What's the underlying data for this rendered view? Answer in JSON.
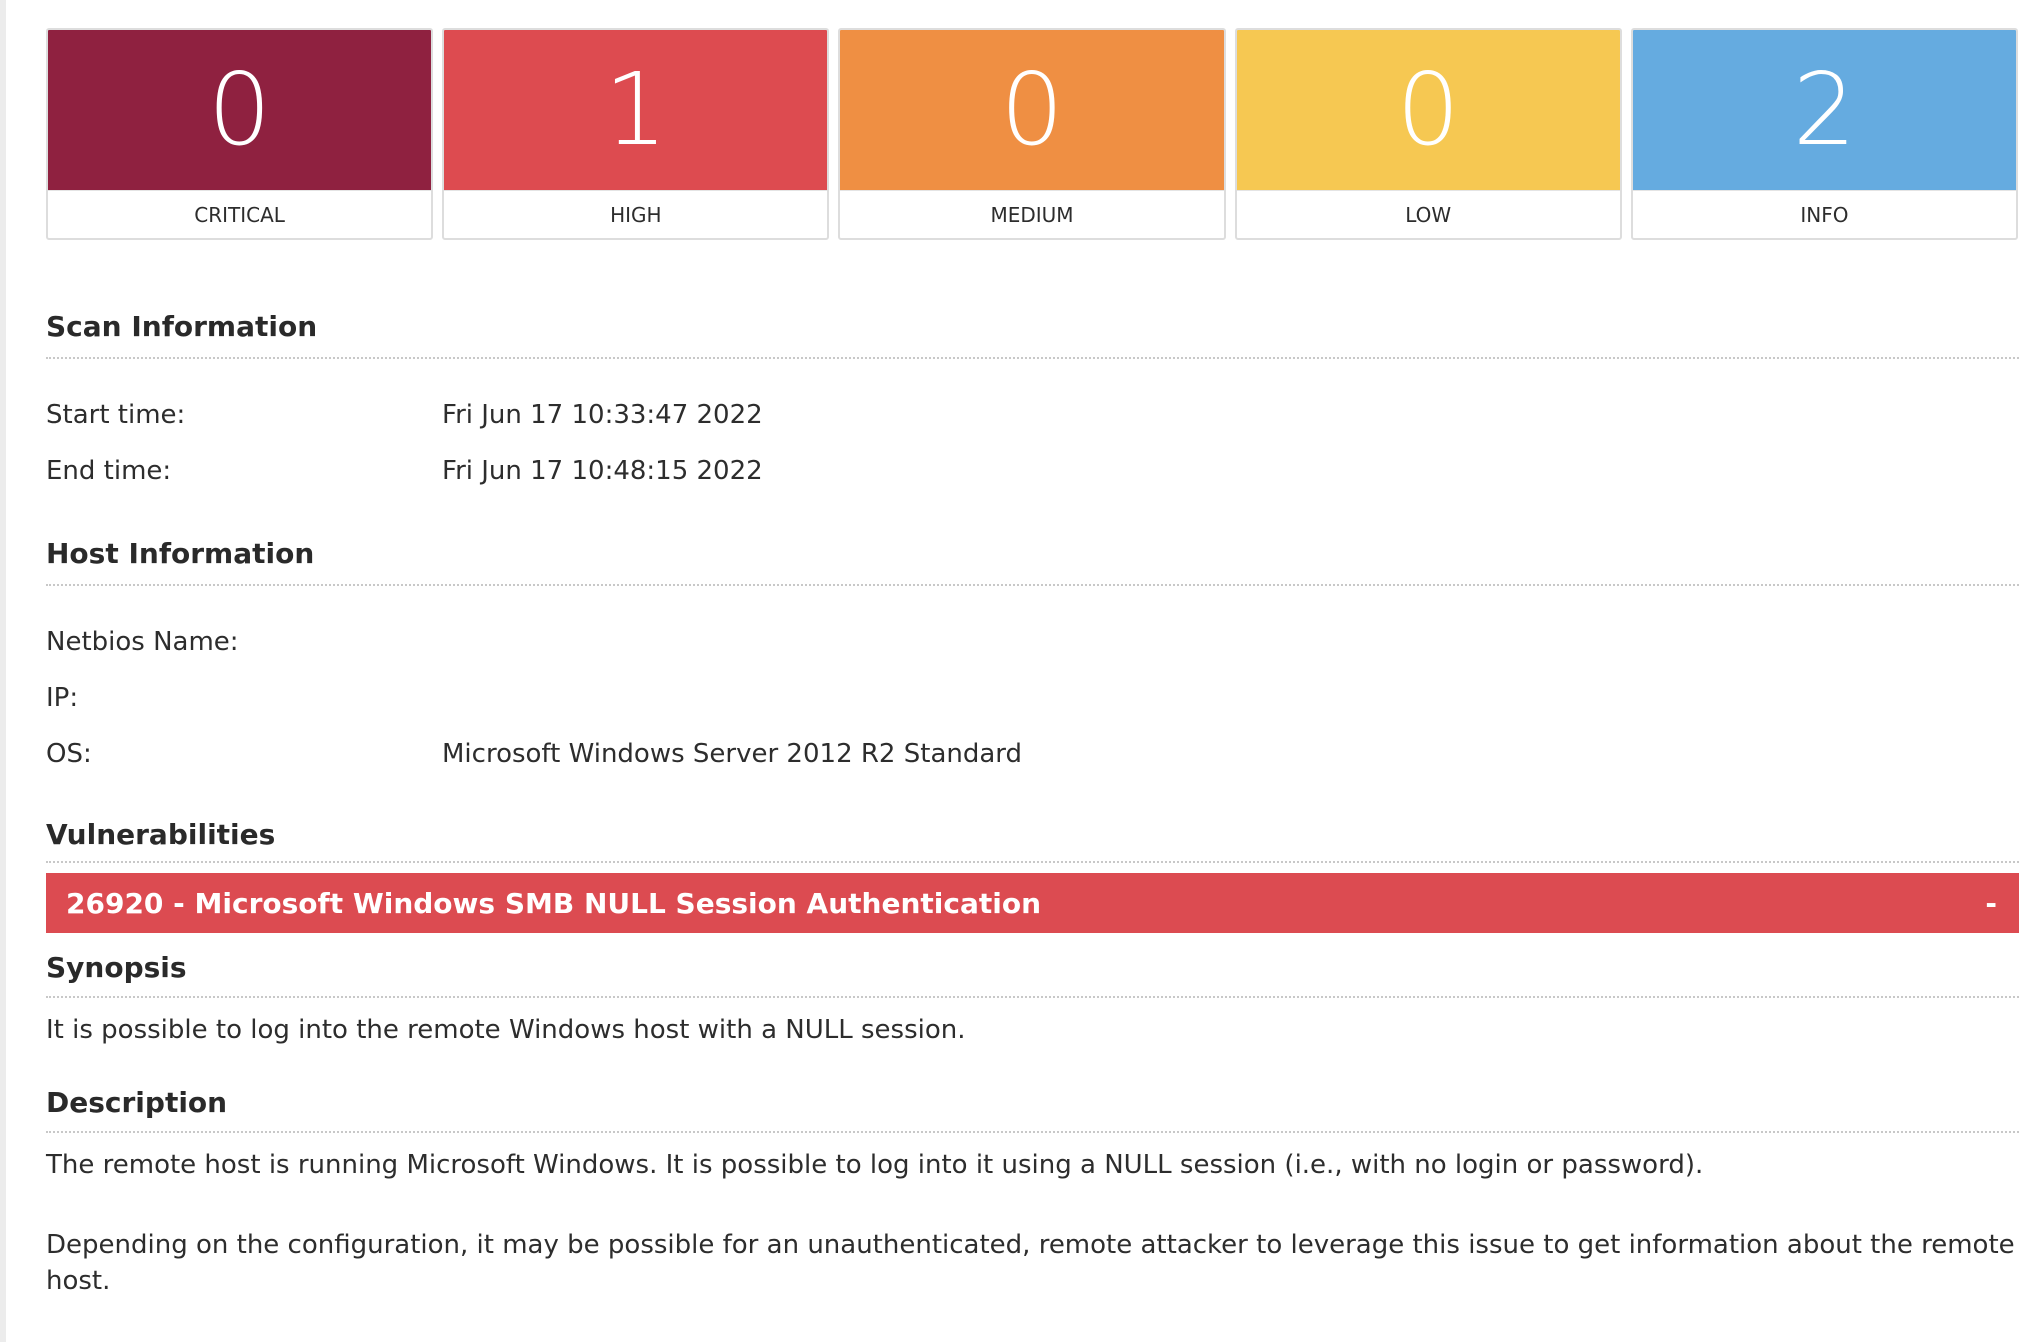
{
  "severity_summary": [
    {
      "label": "CRITICAL",
      "count": "0",
      "color": "#8f2140"
    },
    {
      "label": "HIGH",
      "count": "1",
      "color": "#dd4b50"
    },
    {
      "label": "MEDIUM",
      "count": "0",
      "color": "#ef8f43"
    },
    {
      "label": "LOW",
      "count": "0",
      "color": "#f6c852"
    },
    {
      "label": "INFO",
      "count": "2",
      "color": "#65abe0"
    }
  ],
  "scan_information": {
    "title": "Scan Information",
    "start_time_label": "Start time:",
    "start_time": "Fri Jun 17 10:33:47 2022",
    "end_time_label": "End time:",
    "end_time": "Fri Jun 17 10:48:15 2022"
  },
  "host_information": {
    "title": "Host Information",
    "netbios_label": "Netbios Name:",
    "netbios": "",
    "ip_label": "IP:",
    "ip": "",
    "os_label": "OS:",
    "os": "Microsoft Windows Server 2012 R2 Standard"
  },
  "vulnerabilities": {
    "title": "Vulnerabilities",
    "items": [
      {
        "title": "26920 - Microsoft Windows SMB NULL Session Authentication",
        "collapse_symbol": "-",
        "severity_color": "#dc4b51",
        "synopsis_title": "Synopsis",
        "synopsis": "It is possible to log into the remote Windows host with a NULL session.",
        "description_title": "Description",
        "description_p1": "The remote host is running Microsoft Windows. It is possible to log into it using a NULL session (i.e., with no login or password).",
        "description_p2": "Depending on the configuration, it may be possible for an unauthenticated, remote attacker to leverage this issue to get information about the remote host."
      }
    ]
  }
}
